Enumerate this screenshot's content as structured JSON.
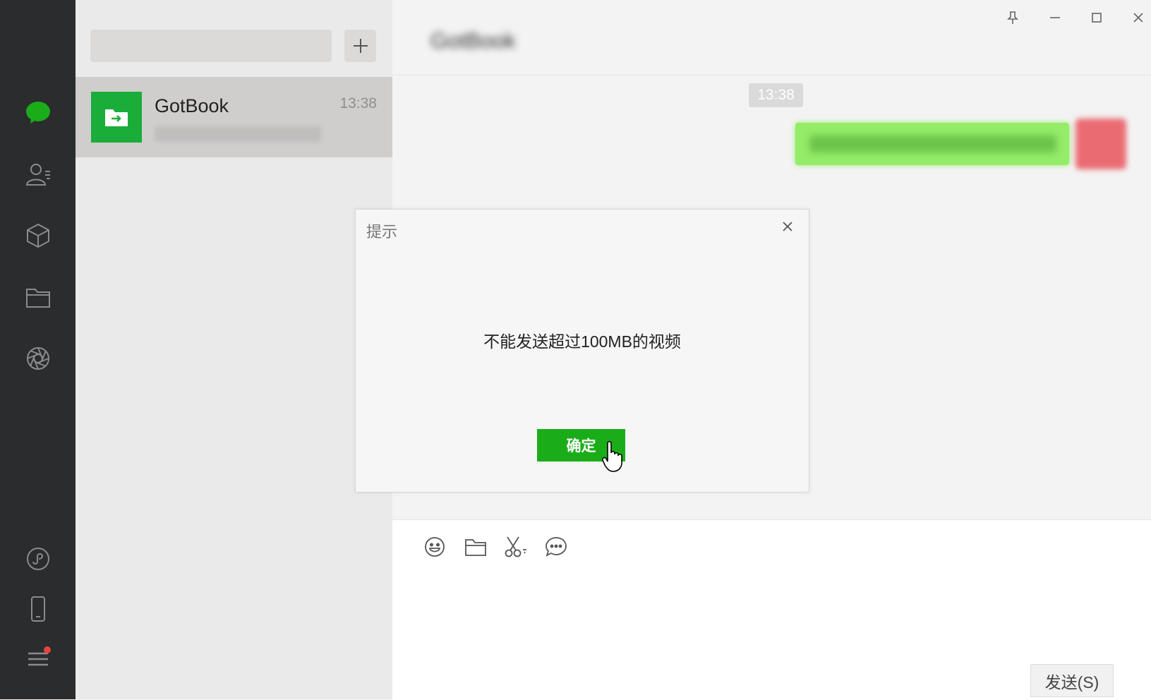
{
  "conversation": {
    "name": "GotBook",
    "time": "13:38"
  },
  "chat": {
    "title": "GotBook",
    "time_separator": "13:38",
    "send_label": "发送(S)"
  },
  "dialog": {
    "title": "提示",
    "message": "不能发送超过100MB的视频",
    "ok_label": "确定"
  },
  "colors": {
    "brand_green": "#1aad19",
    "nav_bg": "#2b2c2e",
    "bubble_green": "#95ec69",
    "badge_red": "#e64340"
  },
  "icons": {
    "nav": [
      "chat-icon",
      "contacts-icon",
      "collections-icon",
      "files-icon",
      "moments-icon",
      "mini-program-icon",
      "phone-icon",
      "menu-icon"
    ],
    "toolbar": [
      "emoji-icon",
      "folder-icon",
      "scissors-icon",
      "chat-bubble-icon"
    ],
    "window": [
      "pin-icon",
      "minimize-icon",
      "maximize-icon",
      "close-icon"
    ]
  }
}
